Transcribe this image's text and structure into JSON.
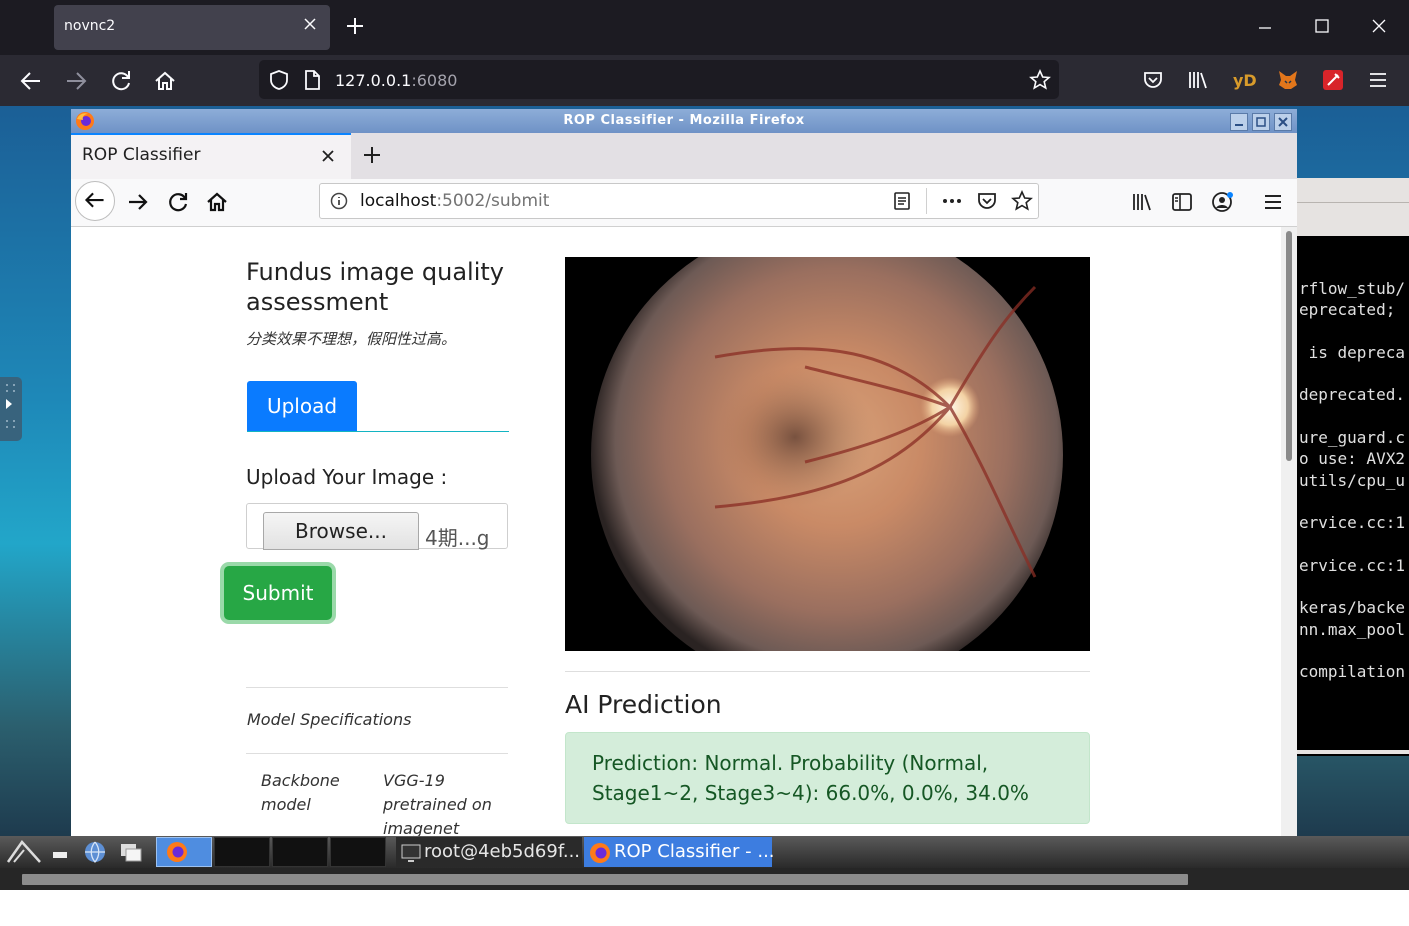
{
  "outer_browser": {
    "tab_title": "novnc2",
    "url_host": "127.0.0.1",
    "url_port": ":6080"
  },
  "inner_browser": {
    "window_title": "ROP Classifier - Mozilla Firefox",
    "tab_title": "ROP Classifier",
    "url_host": "localhost",
    "url_path": ":5002/submit"
  },
  "page": {
    "title": "Fundus image quality assessment",
    "subtitle": "分类效果不理想，假阳性过高。",
    "upload_tab": "Upload",
    "upload_label": "Upload Your Image :",
    "browse_label": "Browse...",
    "file_name": "4期...g",
    "submit_label": "Submit",
    "spec_title": "Model Specifications",
    "spec_key": "Backbone model",
    "spec_value": "VGG-19 pretrained on imagenet",
    "ai_heading": "AI Prediction",
    "prediction": "Prediction: Normal. Probability (Normal, Stage1~2, Stage3~4): 66.0%, 0.0%, 34.0%"
  },
  "terminal": {
    "lines": "rflow_stub/\neprecated;\n\n is depreca\n\ndeprecated.\n\nure_guard.c\no use: AVX2\nutils/cpu_u\n\nervice.cc:1\n\nervice.cc:1\n\nkeras/backe\nnn.max_pool\n\ncompilation"
  },
  "taskbar": {
    "task1": "root@4eb5d69f...",
    "task2": "ROP Classifier - ..."
  }
}
